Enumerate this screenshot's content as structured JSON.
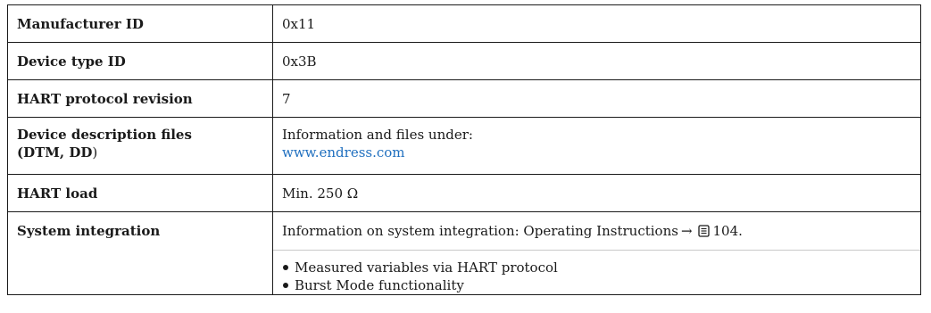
{
  "rows": [
    {
      "label": "Manufacturer ID",
      "value": "0x11"
    },
    {
      "label": "Device type ID",
      "value": "0x3B"
    },
    {
      "label": "HART protocol revision",
      "value": "7"
    },
    {
      "label_line1": "Device description files",
      "label_line2_bold": "(DTM, DD",
      "label_line2_paren": ")",
      "value_line1": "Information and files under:",
      "value_link": "www.endress.com"
    },
    {
      "label": "HART load",
      "value": "Min. 250 Ω"
    },
    {
      "label": "System integration",
      "value_text": "Information on system integration: Operating Instructions",
      "arrow": "→",
      "page_ref": "104.",
      "bullets": [
        "Measured variables via HART protocol",
        "Burst Mode functionality"
      ]
    }
  ],
  "icons": {
    "arrow": "right-arrow-icon",
    "page": "book-icon"
  },
  "colors": {
    "link": "#1f6fbf",
    "border": "#1a1a1a"
  }
}
